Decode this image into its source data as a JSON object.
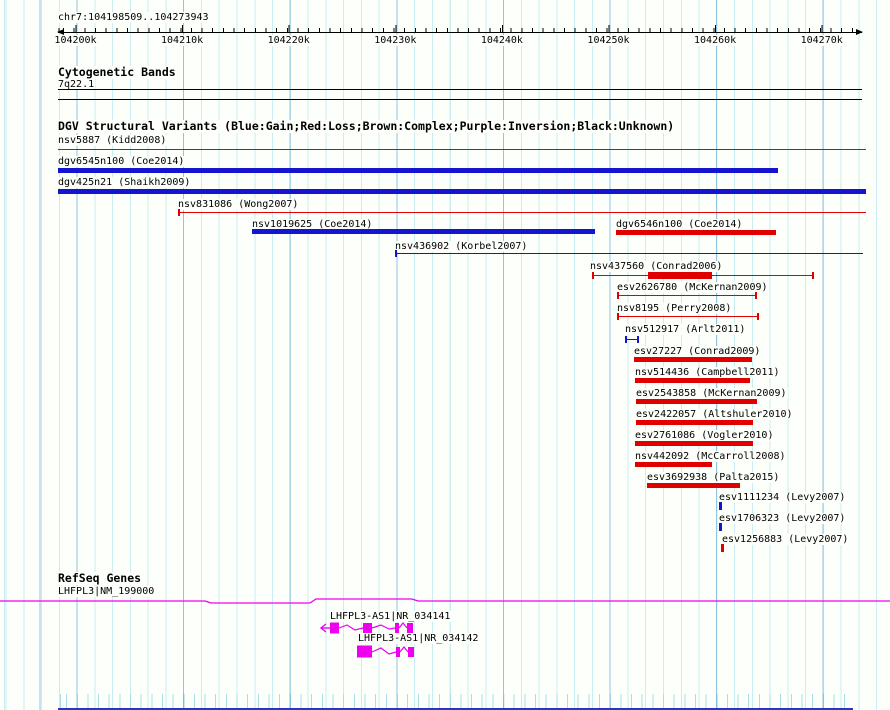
{
  "header": {
    "title": "chr7:104198509..104273943"
  },
  "ruler": {
    "ticks": [
      "104200k",
      "104210k",
      "104220k",
      "104230k",
      "104240k",
      "104250k",
      "104260k",
      "104270k"
    ]
  },
  "cytogenetic": {
    "header": "Cytogenetic Bands",
    "band": "7q22.1"
  },
  "dgv": {
    "header": "DGV Structural Variants (Blue:Gain;Red:Loss;Brown:Complex;Purple:Inversion;Black:Unknown)",
    "variants": [
      {
        "label": "nsv5887 (Kidd2008)",
        "type": "thin-line",
        "color_role": "loss"
      },
      {
        "label": "dgv6545n100 (Coe2014)",
        "type": "thick-bar",
        "color_role": "gain"
      },
      {
        "label": "dgv425n21 (Shaikh2009)",
        "type": "thick-bar",
        "color_role": "gain"
      },
      {
        "label": "nsv831086 (Wong2007)",
        "type": "thin-line",
        "color_role": "loss"
      },
      {
        "label": "nsv1019625 (Coe2014)",
        "type": "thick-bar",
        "color_role": "gain"
      },
      {
        "label": "dgv6546n100 (Coe2014)",
        "type": "thick-bar",
        "color_role": "loss"
      },
      {
        "label": "nsv436902 (Korbel2007)",
        "type": "thin-line",
        "color_role": "gain"
      },
      {
        "label": "nsv437560 (Conrad2006)",
        "type": "bracket-range",
        "color_role": "loss"
      },
      {
        "label": "esv2626780 (McKernan2009)",
        "type": "bracket",
        "color_role": "loss"
      },
      {
        "label": "nsv8195 (Perry2008)",
        "type": "bracket",
        "color_role": "loss"
      },
      {
        "label": "nsv512917 (Arlt2011)",
        "type": "bracket",
        "color_role": "gain"
      },
      {
        "label": "esv27227 (Conrad2009)",
        "type": "thick-bar",
        "color_role": "loss"
      },
      {
        "label": "nsv514436 (Campbell2011)",
        "type": "thick-bar",
        "color_role": "loss"
      },
      {
        "label": "esv2543858 (McKernan2009)",
        "type": "thick-bar",
        "color_role": "loss"
      },
      {
        "label": "esv2422057 (Altshuler2010)",
        "type": "thick-bar",
        "color_role": "loss"
      },
      {
        "label": "esv2761086 (Vogler2010)",
        "type": "thick-bar",
        "color_role": "loss"
      },
      {
        "label": "nsv442092 (McCarroll2008)",
        "type": "thick-bar",
        "color_role": "loss"
      },
      {
        "label": "esv3692938 (Palta2015)",
        "type": "thick-bar",
        "color_role": "loss"
      },
      {
        "label": "esv1111234 (Levy2007)",
        "type": "point",
        "color_role": "gain"
      },
      {
        "label": "esv1706323 (Levy2007)",
        "type": "point",
        "color_role": "gain"
      },
      {
        "label": "esv1256883 (Levy2007)",
        "type": "point",
        "color_role": "loss"
      }
    ]
  },
  "refseq": {
    "header": "RefSeq Genes",
    "genes": [
      {
        "label": "LHFPL3|NM_199000"
      },
      {
        "label": "LHFPL3-AS1|NR_034141"
      },
      {
        "label": "LHFPL3-AS1|NR_034142"
      }
    ]
  },
  "colors": {
    "gain_blue": "#1515d0",
    "loss_red": "#e00000",
    "gene_magenta": "#ee00ee",
    "grid_minor": "#c9edf2",
    "grid_major": "#8ec6e4",
    "bottom_ruler_blue": "#2a35c0"
  }
}
